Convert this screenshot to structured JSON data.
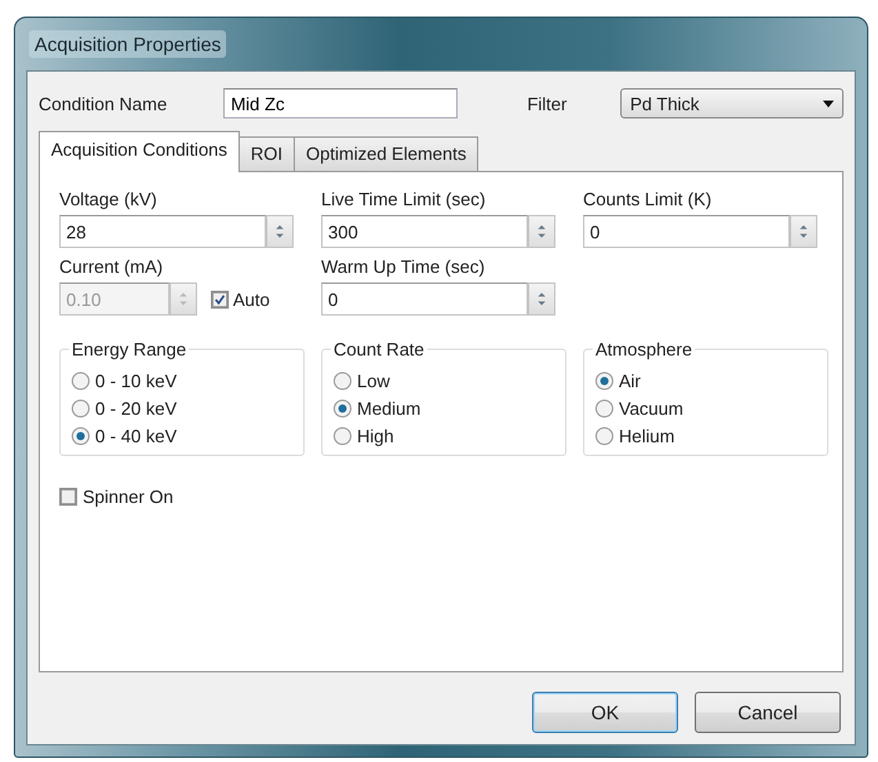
{
  "window": {
    "title": "Acquisition Properties"
  },
  "condition_name": {
    "label": "Condition Name",
    "value": "Mid Zc"
  },
  "filter": {
    "label": "Filter",
    "value": "Pd Thick"
  },
  "tabs": [
    {
      "label": "Acquisition Conditions",
      "selected": true
    },
    {
      "label": "ROI",
      "selected": false
    },
    {
      "label": "Optimized Elements",
      "selected": false
    }
  ],
  "field_rows": [
    [
      {
        "label": "Voltage (kV)",
        "value": "28",
        "disabled": false
      },
      {
        "label": "Live Time Limit (sec)",
        "value": "300",
        "disabled": false
      },
      {
        "label": "Counts Limit (K)",
        "value": "0",
        "disabled": false
      }
    ],
    [
      {
        "label": "Current (mA)",
        "value": "0.10",
        "disabled": true,
        "auto": {
          "label": "Auto",
          "checked": true
        }
      },
      {
        "label": "Warm Up Time (sec)",
        "value": "0",
        "disabled": false
      }
    ]
  ],
  "groups": [
    {
      "title": "Energy Range",
      "options": [
        {
          "label": "0 - 10 keV",
          "selected": false
        },
        {
          "label": "0 - 20 keV",
          "selected": false
        },
        {
          "label": "0 - 40 keV",
          "selected": true
        }
      ]
    },
    {
      "title": "Count Rate",
      "options": [
        {
          "label": "Low",
          "selected": false
        },
        {
          "label": "Medium",
          "selected": true
        },
        {
          "label": "High",
          "selected": false
        }
      ]
    },
    {
      "title": "Atmosphere",
      "options": [
        {
          "label": "Air",
          "selected": true
        },
        {
          "label": "Vacuum",
          "selected": false
        },
        {
          "label": "Helium",
          "selected": false
        }
      ]
    }
  ],
  "spinner": {
    "label": "Spinner On",
    "checked": false
  },
  "buttons": [
    {
      "label": "OK",
      "default": true
    },
    {
      "label": "Cancel",
      "default": false
    }
  ]
}
